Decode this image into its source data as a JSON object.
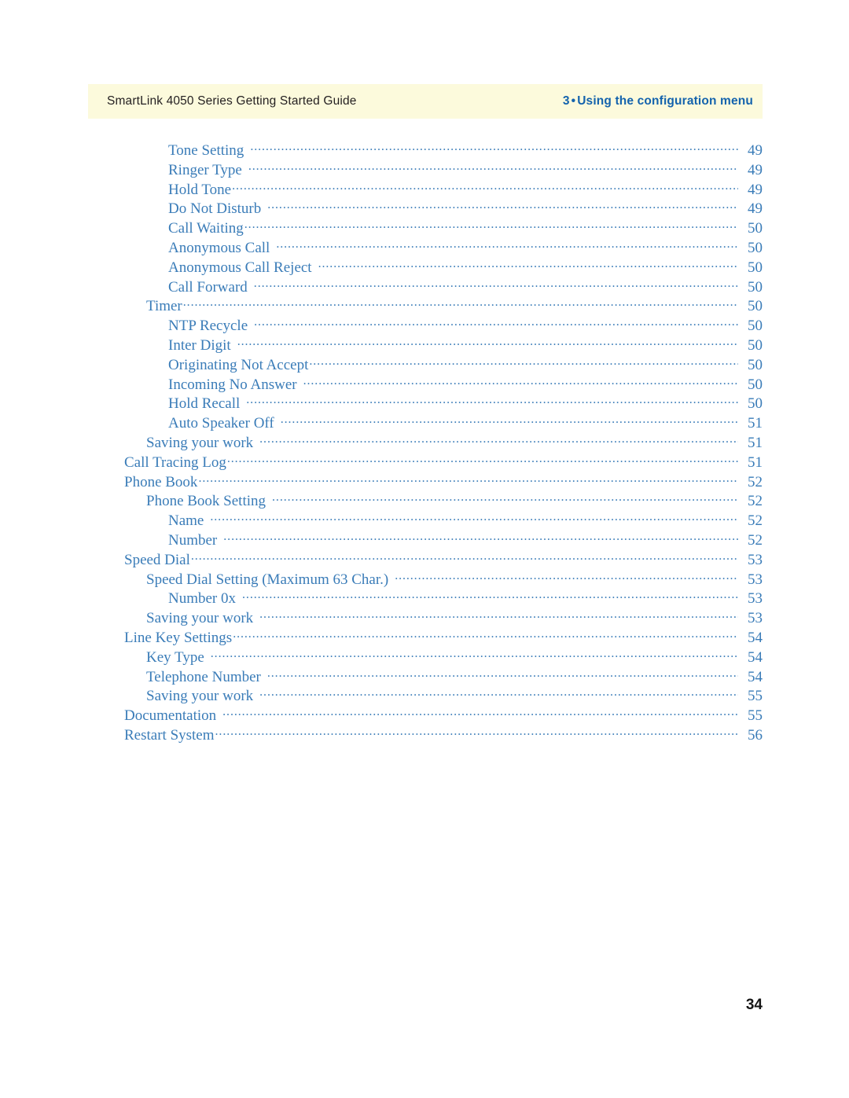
{
  "header": {
    "left_title": "SmartLink 4050 Series Getting Started Guide",
    "chapter_number": "3",
    "bullet": "•",
    "chapter_title": "Using the configuration menu",
    "band_color": "#fcfadc",
    "accent_color": "#1463ad"
  },
  "toc": {
    "text_color": "#3a7cb8",
    "entries": [
      {
        "label": "Tone Setting",
        "page": "49",
        "level": 2,
        "gap": "wide"
      },
      {
        "label": "Ringer Type",
        "page": "49",
        "level": 2,
        "gap": "wide"
      },
      {
        "label": "Hold Tone",
        "page": "49",
        "level": 2,
        "gap": "tight"
      },
      {
        "label": "Do Not Disturb",
        "page": "49",
        "level": 2,
        "gap": "wide"
      },
      {
        "label": "Call Waiting",
        "page": "50",
        "level": 2,
        "gap": "tight"
      },
      {
        "label": "Anonymous Call",
        "page": "50",
        "level": 2,
        "gap": "wide"
      },
      {
        "label": "Anonymous Call Reject",
        "page": "50",
        "level": 2,
        "gap": "wide"
      },
      {
        "label": "Call Forward",
        "page": "50",
        "level": 2,
        "gap": "wide"
      },
      {
        "label": "Timer",
        "page": "50",
        "level": 1,
        "gap": "tight"
      },
      {
        "label": "NTP Recycle",
        "page": "50",
        "level": 2,
        "gap": "wide"
      },
      {
        "label": "Inter Digit",
        "page": "50",
        "level": 2,
        "gap": "wide"
      },
      {
        "label": "Originating Not Accept",
        "page": "50",
        "level": 2,
        "gap": "tight"
      },
      {
        "label": "Incoming No Answer",
        "page": "50",
        "level": 2,
        "gap": "wide"
      },
      {
        "label": "Hold Recall",
        "page": "50",
        "level": 2,
        "gap": "wide"
      },
      {
        "label": "Auto Speaker Off",
        "page": "51",
        "level": 2,
        "gap": "wide"
      },
      {
        "label": "Saving your work",
        "page": "51",
        "level": 1,
        "gap": "wide"
      },
      {
        "label": "Call Tracing Log",
        "page": "51",
        "level": 0,
        "gap": "tight"
      },
      {
        "label": "Phone Book",
        "page": "52",
        "level": 0,
        "gap": "tight"
      },
      {
        "label": "Phone Book Setting",
        "page": "52",
        "level": 1,
        "gap": "wide"
      },
      {
        "label": "Name",
        "page": "52",
        "level": 2,
        "gap": "wide"
      },
      {
        "label": "Number",
        "page": "52",
        "level": 2,
        "gap": "wide"
      },
      {
        "label": "Speed Dial",
        "page": "53",
        "level": 0,
        "gap": "tight"
      },
      {
        "label": "Speed Dial Setting (Maximum 63 Char.)",
        "page": "53",
        "level": 1,
        "gap": "wide"
      },
      {
        "label": "Number 0x",
        "page": "53",
        "level": 2,
        "gap": "wide"
      },
      {
        "label": "Saving your work",
        "page": "53",
        "level": 1,
        "gap": "wide"
      },
      {
        "label": "Line Key Settings",
        "page": "54",
        "level": 0,
        "gap": "tight"
      },
      {
        "label": "Key Type",
        "page": "54",
        "level": 1,
        "gap": "wide"
      },
      {
        "label": "Telephone Number",
        "page": "54",
        "level": 1,
        "gap": "wide"
      },
      {
        "label": "Saving your work",
        "page": "55",
        "level": 1,
        "gap": "wide"
      },
      {
        "label": "Documentation",
        "page": "55",
        "level": 0,
        "gap": "wide"
      },
      {
        "label": "Restart System",
        "page": "56",
        "level": 0,
        "gap": "tight"
      }
    ]
  },
  "folio": {
    "page_number": "34"
  }
}
